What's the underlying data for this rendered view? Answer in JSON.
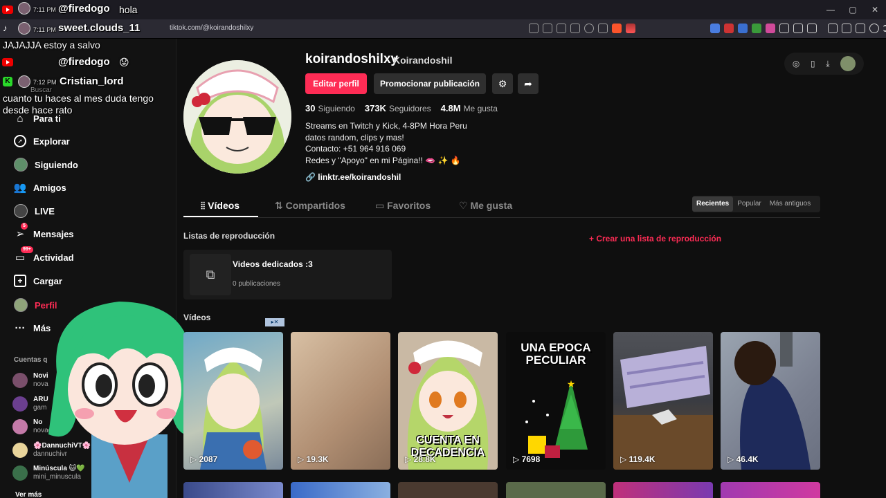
{
  "overlay": {
    "chat": [
      {
        "time": "7:11 PM",
        "user": "@firedogo",
        "msg": "hola"
      },
      {
        "time": "7:11 PM",
        "user": "sweet.clouds_11"
      },
      {
        "msg": "JAJAJJA estoy a salvo"
      },
      {
        "user": "@firedogo"
      },
      {
        "time": "7:12 PM",
        "user": "Cristian_lord"
      },
      {
        "msg": "cuanto tu haces al mes duda tengo desde hace rato"
      }
    ],
    "search_placeholder": "Buscar"
  },
  "browser": {
    "url": "tiktok.com/@koirandoshilxy",
    "window_controls": [
      "—",
      "▢",
      "✕"
    ]
  },
  "sidebar": {
    "items": [
      {
        "label": "Para ti",
        "icon": "home-icon"
      },
      {
        "label": "Explorar",
        "icon": "compass-icon"
      },
      {
        "label": "Siguiendo",
        "icon": "following-avatar"
      },
      {
        "label": "Amigos",
        "icon": "friends-icon"
      },
      {
        "label": "LIVE",
        "icon": "live-icon"
      },
      {
        "label": "Mensajes",
        "icon": "messages-icon",
        "badge": "5"
      },
      {
        "label": "Actividad",
        "icon": "activity-icon",
        "badge": "99+"
      },
      {
        "label": "Cargar",
        "icon": "upload-icon"
      },
      {
        "label": "Perfil",
        "icon": "profile-avatar"
      },
      {
        "label": "Más",
        "icon": "more-icon"
      }
    ],
    "following_heading": "Cuentas q",
    "accounts": [
      {
        "name": "Novi",
        "handle": "nova"
      },
      {
        "name": "ARU",
        "handle": "gam"
      },
      {
        "name": "No",
        "handle": "novadash_"
      },
      {
        "name": "🌸DannuchiVT🌸",
        "handle": "dannuchivr"
      },
      {
        "name": "Minúscula 🐱💚",
        "handle": "mini_minuscula"
      }
    ],
    "see_more": "Ver más"
  },
  "profile": {
    "username": "koirandoshilxy",
    "nickname": "Koirandoshil",
    "edit_label": "Editar perfil",
    "promote_label": "Promocionar publicación",
    "stats": [
      {
        "value": "30",
        "label": "Siguiendo"
      },
      {
        "value": "373K",
        "label": "Seguidores"
      },
      {
        "value": "4.8M",
        "label": "Me gusta"
      }
    ],
    "bio": [
      "Streams en Twitch y Kick, 4-8PM Hora Peru",
      "datos random, clips y mas!",
      "Contacto: +51 964 916 069",
      "Redes y \"Apoyo\" en mi Página!! 🫦 ✨ 🔥"
    ],
    "link": "linktr.ee/koirandoshil"
  },
  "tabs": [
    {
      "label": "Vídeos",
      "active": true
    },
    {
      "label": "Compartidos"
    },
    {
      "label": "Favoritos"
    },
    {
      "label": "Me gusta"
    }
  ],
  "sort": [
    "Recientes",
    "Popular",
    "Más antiguos"
  ],
  "playlists": {
    "heading": "Listas de reproducción",
    "create": "+ Crear una lista de reproducción",
    "items": [
      {
        "title": "Videos dedicados :3",
        "count": "0 publicaciones"
      }
    ]
  },
  "videos": {
    "heading": "Vídeos",
    "items": [
      {
        "views": "2087"
      },
      {
        "views": "19.3K"
      },
      {
        "views": "28.8K",
        "caption_bottom": "CUENTA EN DECADENCIA"
      },
      {
        "views": "7698",
        "caption_top": "UNA EPOCA PECULIAR"
      },
      {
        "views": "119.4K"
      },
      {
        "views": "46.4K"
      }
    ]
  },
  "colors": {
    "accent": "#fe2c55",
    "bg": "#0f0f0f"
  }
}
